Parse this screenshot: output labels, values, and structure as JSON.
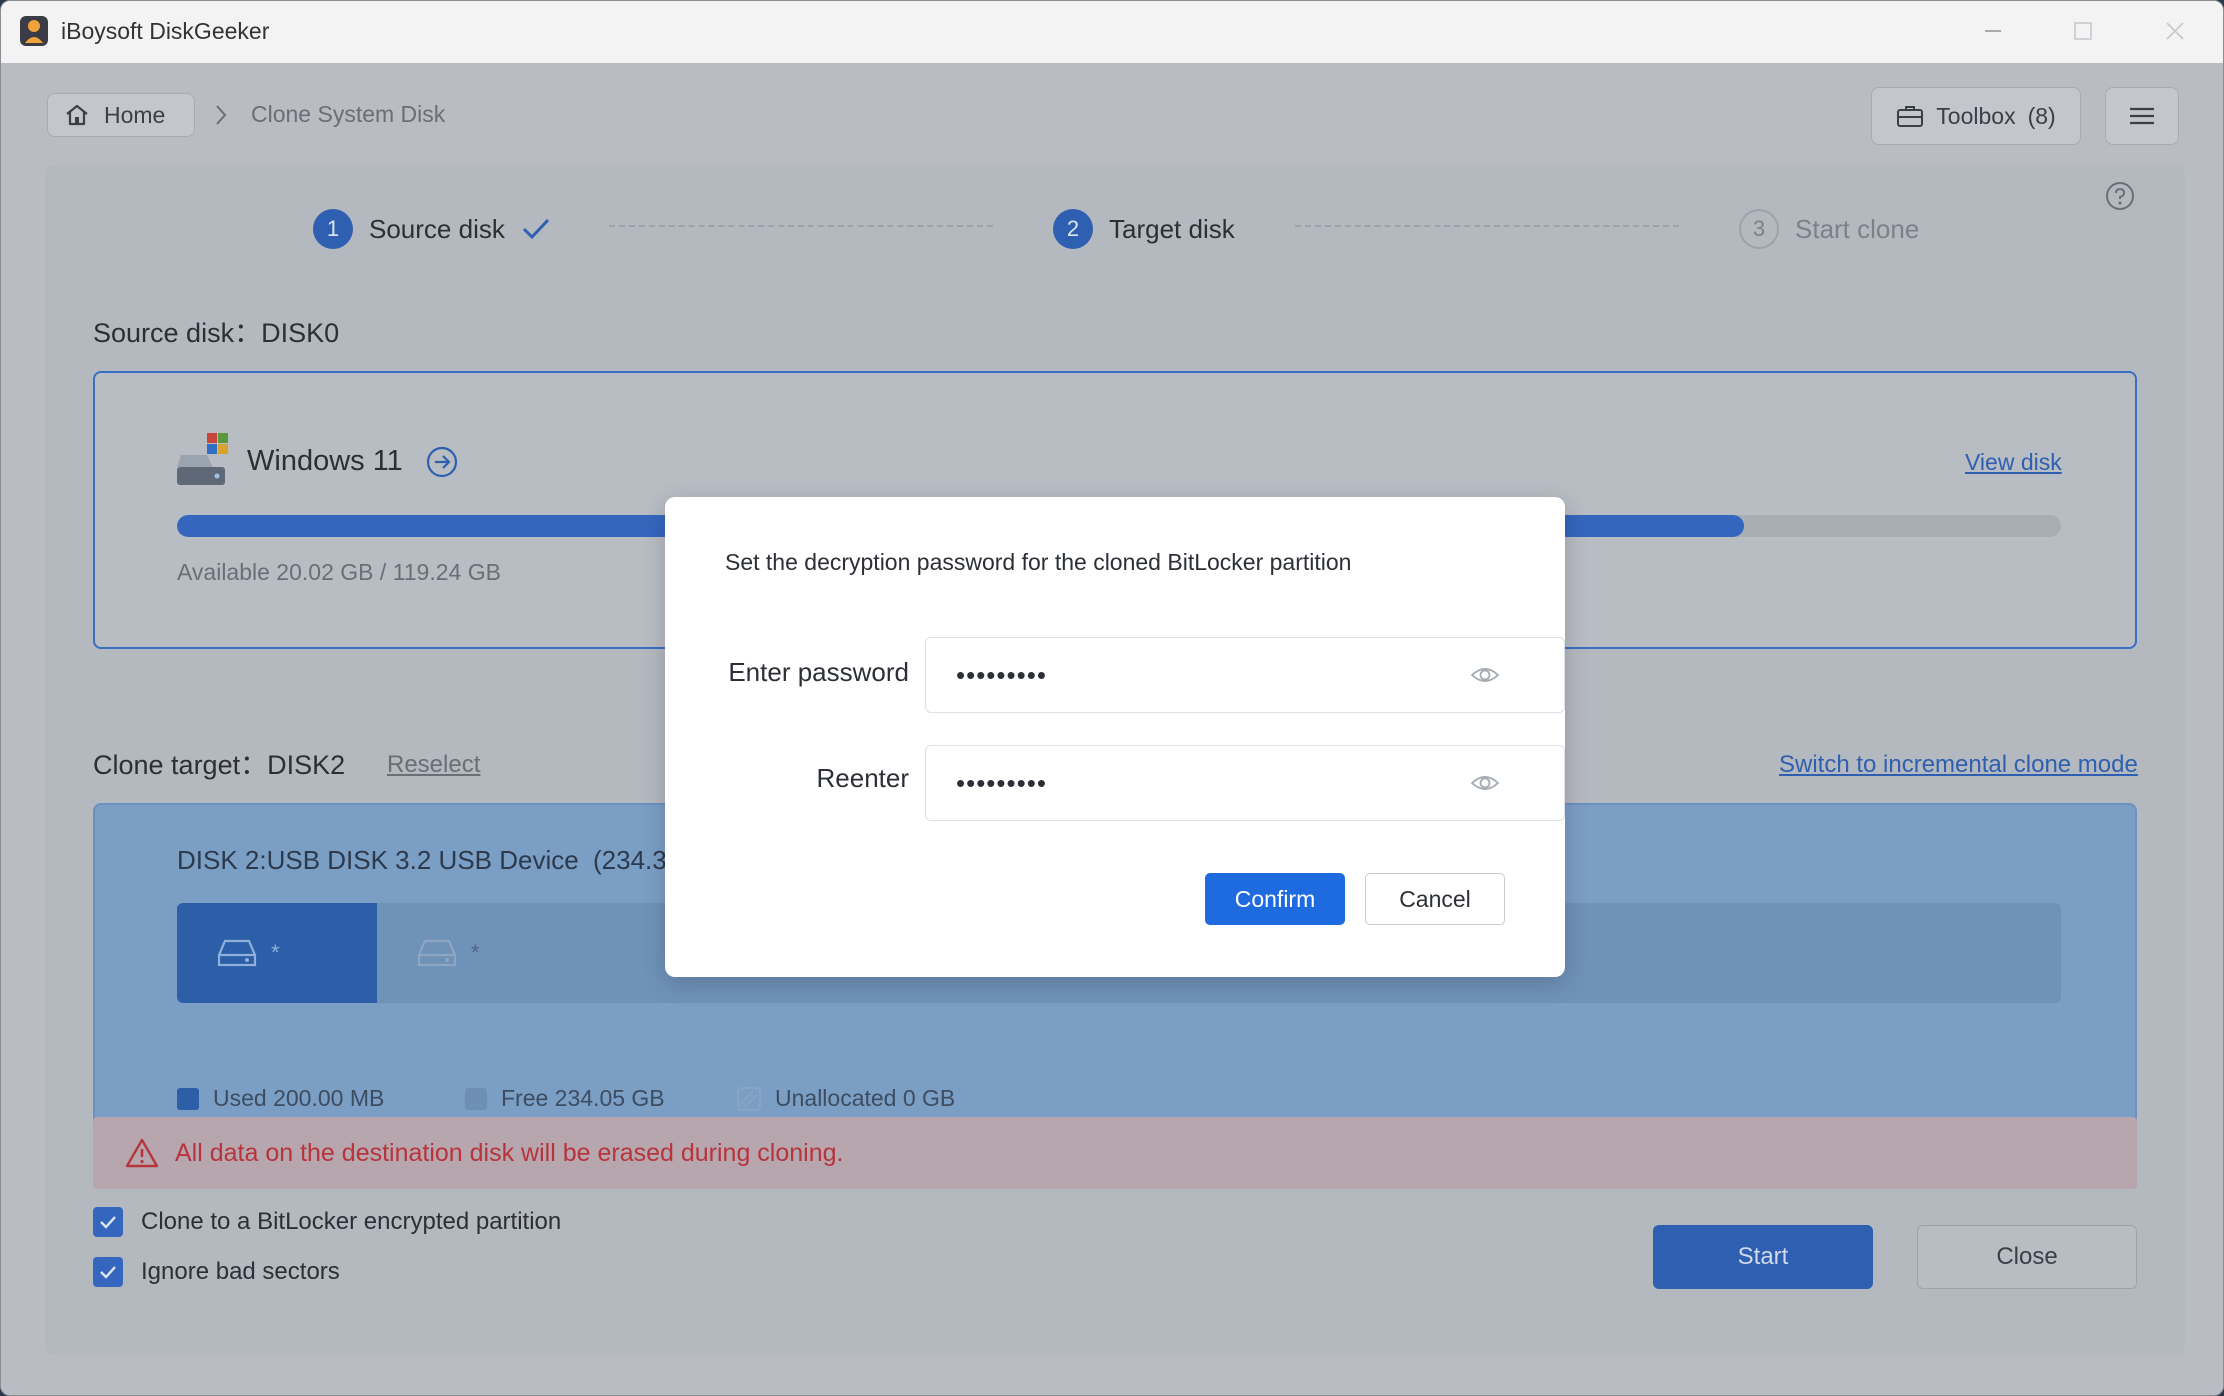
{
  "app": {
    "title": "iBoysoft DiskGeeker"
  },
  "nav": {
    "home_label": "Home",
    "current": "Clone System Disk",
    "toolbox_label": "Toolbox",
    "toolbox_count": "(8)"
  },
  "steps": [
    {
      "num": "1",
      "label": "Source disk",
      "state": "done"
    },
    {
      "num": "2",
      "label": "Target disk",
      "state": "active"
    },
    {
      "num": "3",
      "label": "Start clone",
      "state": "pending"
    }
  ],
  "source": {
    "label": "Source disk：DISK0",
    "disk_name": "Windows 11",
    "view_disk": "View disk",
    "used_fraction": 0.832,
    "available_text": "Available 20.02 GB / 119.24 GB"
  },
  "target": {
    "label": "Clone target：DISK2",
    "reselect": "Reselect",
    "switch_mode": "Switch to incremental clone mode",
    "disk_title": "DISK 2:USB DISK 3.2 USB Device",
    "disk_size": "(234.3",
    "partition_used_label": "*",
    "partition_free_label": "*",
    "legend": {
      "used": "Used 200.00 MB",
      "free": "Free 234.05 GB",
      "unallocated": "Unallocated 0 GB"
    }
  },
  "warning": {
    "text": "All data on the destination disk will be erased during cloning."
  },
  "options": {
    "bitlocker": {
      "label": "Clone to a BitLocker encrypted partition",
      "checked": true
    },
    "ignore_bad": {
      "label": "Ignore bad sectors",
      "checked": true
    }
  },
  "actions": {
    "start": "Start",
    "close": "Close"
  },
  "modal": {
    "title": "Set the decryption password for the cloned BitLocker partition",
    "password_label": "Enter password",
    "password_value": "•••••••••",
    "reenter_label": "Reenter",
    "reenter_value": "•••••••••",
    "confirm": "Confirm",
    "cancel": "Cancel"
  },
  "colors": {
    "accent": "#2f5fb0",
    "primary_button": "#1e6be0",
    "warning_text": "#b7343d"
  }
}
